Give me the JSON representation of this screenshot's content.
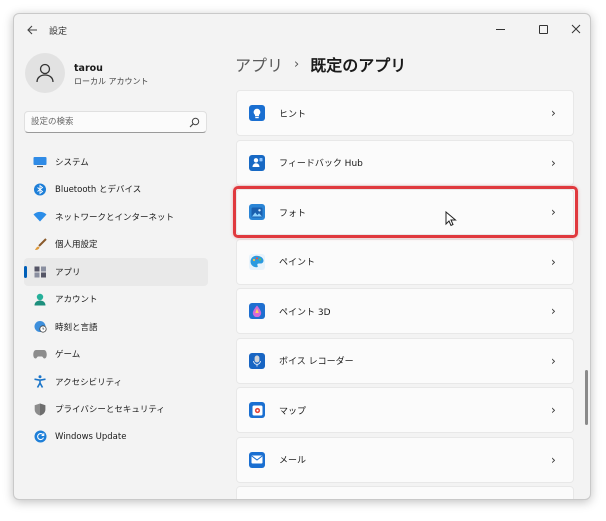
{
  "window": {
    "title": "設定"
  },
  "user": {
    "name": "tarou",
    "account_type": "ローカル アカウント"
  },
  "search": {
    "placeholder": "設定の検索"
  },
  "nav": {
    "items": [
      {
        "label": "システム",
        "icon": "monitor-icon"
      },
      {
        "label": "Bluetooth とデバイス",
        "icon": "bluetooth-icon"
      },
      {
        "label": "ネットワークとインターネット",
        "icon": "wifi-icon"
      },
      {
        "label": "個人用設定",
        "icon": "brush-icon"
      },
      {
        "label": "アプリ",
        "icon": "apps-icon",
        "selected": true
      },
      {
        "label": "アカウント",
        "icon": "person-icon"
      },
      {
        "label": "時刻と言語",
        "icon": "globe-clock-icon"
      },
      {
        "label": "ゲーム",
        "icon": "gamepad-icon"
      },
      {
        "label": "アクセシビリティ",
        "icon": "accessibility-icon"
      },
      {
        "label": "プライバシーとセキュリティ",
        "icon": "shield-icon"
      },
      {
        "label": "Windows Update",
        "icon": "update-icon"
      }
    ]
  },
  "breadcrumb": {
    "parent": "アプリ",
    "separator": "›",
    "current": "既定のアプリ"
  },
  "apps": [
    {
      "label": "ヒント",
      "icon": "tips-icon"
    },
    {
      "label": "フィードバック Hub",
      "icon": "feedback-hub-icon"
    },
    {
      "label": "フォト",
      "icon": "photos-icon"
    },
    {
      "label": "ペイント",
      "icon": "paint-icon"
    },
    {
      "label": "ペイント 3D",
      "icon": "paint-3d-icon"
    },
    {
      "label": "ボイス レコーダー",
      "icon": "voice-recorder-icon"
    },
    {
      "label": "マップ",
      "icon": "maps-icon"
    },
    {
      "label": "メール",
      "icon": "mail-icon"
    }
  ],
  "colors": {
    "accent": "#005fb8",
    "highlight": "#e0393e",
    "window_bg": "#f3f3f3",
    "card_bg": "#fbfbfb"
  }
}
